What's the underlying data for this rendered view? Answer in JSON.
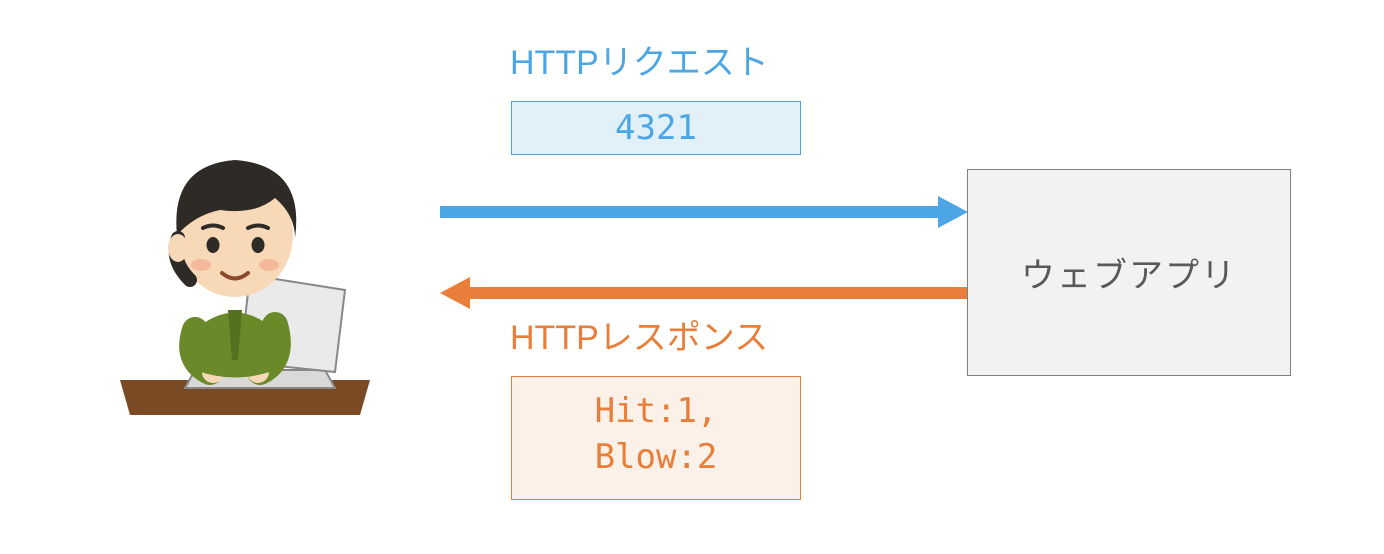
{
  "request": {
    "label": "HTTPリクエスト",
    "payload": "4321"
  },
  "response": {
    "label": "HTTPレスポンス",
    "payload_line1": "Hit:1,",
    "payload_line2": "Blow:2"
  },
  "webapp": {
    "label": "ウェブアプリ"
  }
}
